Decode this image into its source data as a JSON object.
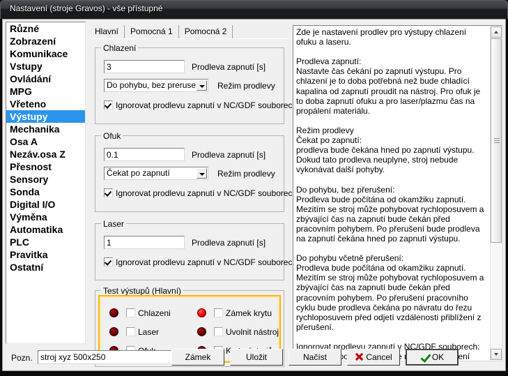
{
  "window": {
    "title": "Nastavení (stroje Gravos) - vše přístupné"
  },
  "sidebar": {
    "items": [
      {
        "label": "Různé",
        "selected": false
      },
      {
        "label": "Zobrazení",
        "selected": false
      },
      {
        "label": "Komunikace",
        "selected": false
      },
      {
        "label": "Vstupy",
        "selected": false
      },
      {
        "label": "Ovládání",
        "selected": false
      },
      {
        "label": "MPG",
        "selected": false
      },
      {
        "label": "Vřeteno",
        "selected": false
      },
      {
        "label": "Výstupy",
        "selected": true
      },
      {
        "label": "Mechanika",
        "selected": false
      },
      {
        "label": "Osa A",
        "selected": false
      },
      {
        "label": "Nezáv.osa Z",
        "selected": false
      },
      {
        "label": "Přesnost",
        "selected": false
      },
      {
        "label": "Sensory",
        "selected": false
      },
      {
        "label": "Sonda",
        "selected": false
      },
      {
        "label": "Digital I/O",
        "selected": false
      },
      {
        "label": "Výměna",
        "selected": false
      },
      {
        "label": "Automatika",
        "selected": false
      },
      {
        "label": "PLC",
        "selected": false
      },
      {
        "label": "Pravitka",
        "selected": false
      },
      {
        "label": "Ostatní",
        "selected": false
      }
    ]
  },
  "tabs": [
    {
      "label": "Hlavní",
      "active": true
    },
    {
      "label": "Pomocná 1",
      "active": false
    },
    {
      "label": "Pomocná 2",
      "active": false
    }
  ],
  "groups": {
    "chlazeni": {
      "title": "Chlazení",
      "delay_value": "3",
      "delay_label": "Prodleva zapnutí [s]",
      "mode_value": "Do pohybu, bez prerusení",
      "mode_label": "Režim prodlevy",
      "ignore_label": "Ignorovat prodlevu zapnutí v NC/GDF souborech",
      "ignore_checked": true
    },
    "ofuk": {
      "title": "Ofuk",
      "delay_value": "0.1",
      "delay_label": "Prodleva zapnutí [s]",
      "mode_value": "Čekat po zapnutí",
      "mode_label": "Režim prodlevy",
      "ignore_label": "Ignorovat prodlevu zapnutí v NC/GDF souborech",
      "ignore_checked": true
    },
    "laser": {
      "title": "Laser",
      "delay_value": "1",
      "delay_label": "Prodleva zapnutí [s]",
      "ignore_label": "Ignorovat prodlevu zapnutí v NC/GDF souborech",
      "ignore_checked": true
    },
    "test": {
      "title": "Test výstupů (Hlavní)",
      "border_color": "#ffb400",
      "led_on_color": "#f90000",
      "led_off_color": "#6e0202",
      "left_items": [
        {
          "label": "Chlazeni",
          "led": "off",
          "checked": false
        },
        {
          "label": "Laser",
          "led": "off",
          "checked": false
        },
        {
          "label": "Ofuk",
          "led": "off",
          "checked": false
        }
      ],
      "right_items": [
        {
          "label": "Zámek krytu",
          "led": "on",
          "checked": false
        },
        {
          "label": "Uvolnit nástroj",
          "led": "off",
          "checked": false
        },
        {
          "label": "Kryt nástrojů",
          "led": "off",
          "checked": false
        }
      ]
    }
  },
  "help": {
    "text": "Zde je nastavení prodlev pro výstupy chlazení ofuku a laseru.\n\nProdleva zapnutí:\nNastavte čas čekání po zapnutí výstupu. Pro chlazení je to doba potřebná než bude chladící kapalina od zapnutí proudit na nástroj. Pro ofuk je to doba zapnutí ofuku a pro laser/plazmu čas na propálení materiálu.\n\nRežim prodlevy\nČekat po zapnutí:\nprodleva bude čekána hned po zapnutí výstupu. Dokud tato prodleva neuplyne, stroj nebude vykonávat další pohyby.\n\nDo pohybu, bez přerušení:\nProdleva bude počítána od okamžiku zapnutí. Mezitím se stroj může pohybovat rychloposuvem a zbývající čas na zapnutí bude čekán před pracovním pohybem. Po přerušení bude prodleva na zapnutí čekána hned po zapnutí výstupu.\n\nDo pohybu včetně přerušení:\nProdleva bude počítána od okamžiku zapnutí. Mezitím se stroj může pohybovat rychloposuvem a zbývající čas na zapnutí bude čekán před pracovním pohybem. Po přerušení pracovního cyklu bude prodleva čekána po návratu do řezu rychloposuvem před odjetí vzdálenosti přiblížení z přerušení.\n\nIgnorovat prodlevu zapnutí v NC/GDF souborech:\nTuto funkci použijte pokud je použito nastavení prodlev nebo bude prodleva spuštění výstupu řízena z PLC. Tato funkce ignoruje prodlevy nastavené v NC nebo GDF"
  },
  "bottom": {
    "pozn_label": "Pozn.",
    "pozn_value": "stroj xyz 500x250",
    "zamek_label": "Zámek",
    "ulozit_label": "Uložit",
    "nacist_label": "Načíst",
    "cancel_label": "Cancel",
    "ok_label": "OK"
  }
}
